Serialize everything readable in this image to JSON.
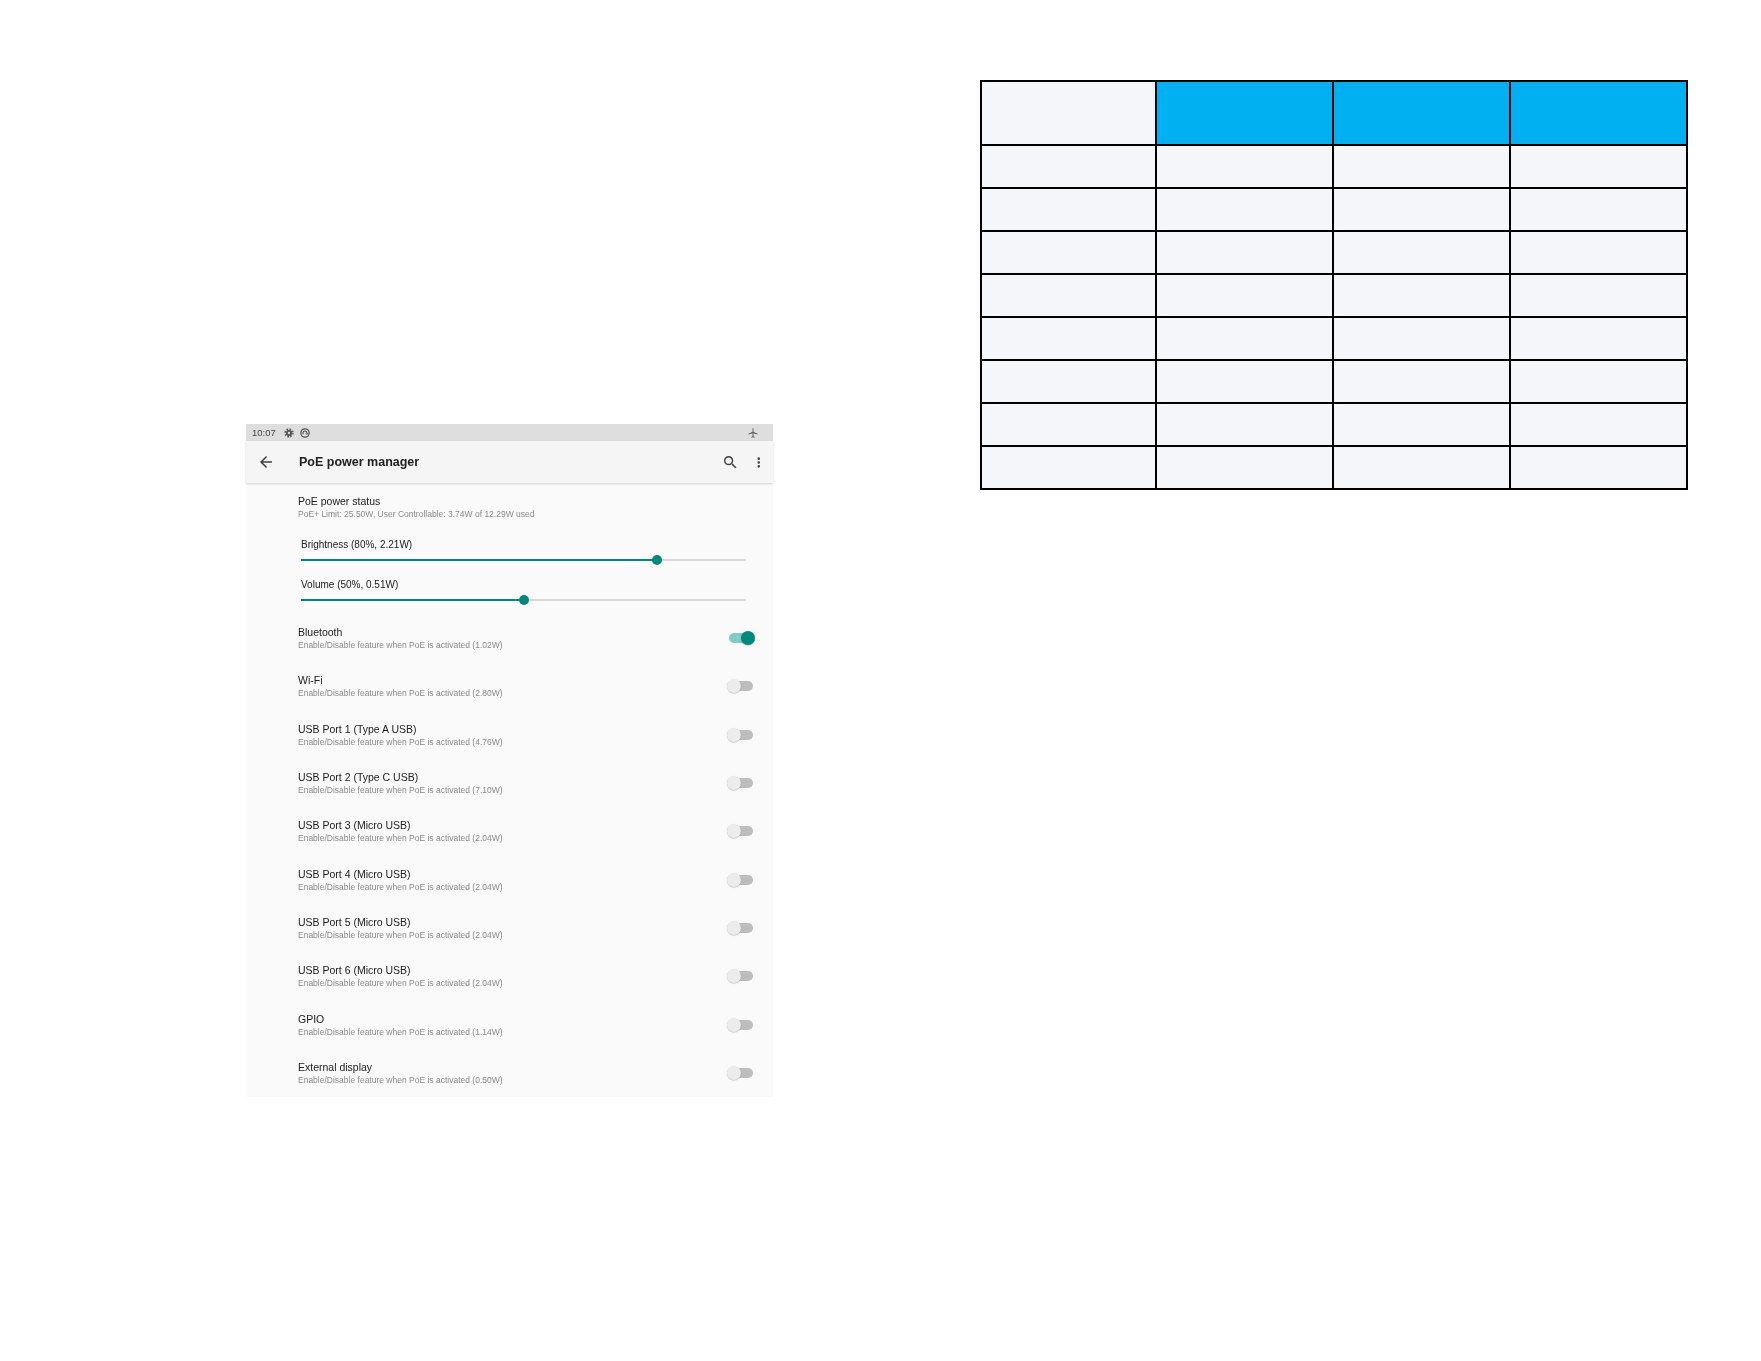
{
  "status_bar": {
    "time": "10:07"
  },
  "app_bar": {
    "title": "PoE power manager"
  },
  "power_status": {
    "title": "PoE power status",
    "summary": "PoE+ Limit: 25.50W, User Controllable: 3.74W of 12.29W used"
  },
  "sliders": [
    {
      "label": "Brightness (80%, 2.21W)",
      "level": 0.8
    },
    {
      "label": "Volume (50%, 0.51W)",
      "level": 0.5
    }
  ],
  "features": [
    {
      "name": "Bluetooth",
      "description": "Enable/Disable feature when PoE is activated (1.02W)",
      "on": true
    },
    {
      "name": "Wi-Fi",
      "description": "Enable/Disable feature when PoE is activated (2.80W)",
      "on": false
    },
    {
      "name": "USB Port 1 (Type A USB)",
      "description": "Enable/Disable feature when PoE is activated (4.76W)",
      "on": false
    },
    {
      "name": "USB Port 2 (Type C USB)",
      "description": "Enable/Disable feature when PoE is activated (7.10W)",
      "on": false
    },
    {
      "name": "USB Port 3 (Micro USB)",
      "description": "Enable/Disable feature when PoE is activated (2.04W)",
      "on": false
    },
    {
      "name": "USB Port 4 (Micro USB)",
      "description": "Enable/Disable feature when PoE is activated (2.04W)",
      "on": false
    },
    {
      "name": "USB Port 5 (Micro USB)",
      "description": "Enable/Disable feature when PoE is activated (2.04W)",
      "on": false
    },
    {
      "name": "USB Port 6 (Micro USB)",
      "description": "Enable/Disable feature when PoE is activated (2.04W)",
      "on": false
    },
    {
      "name": "GPIO",
      "description": "Enable/Disable feature when PoE is activated (1.14W)",
      "on": false
    },
    {
      "name": "External display",
      "description": "Enable/Disable feature when PoE is activated (0.50W)",
      "on": false
    }
  ],
  "table": {
    "header_cells": [
      {
        "color": "#f5f6fa"
      },
      {
        "color": "#00b0f0"
      },
      {
        "color": "#00b0f0"
      },
      {
        "color": "#00b0f0"
      }
    ],
    "rows": [
      {
        "cells": [
          {
            "color": "#f5f6fa"
          },
          {
            "color": "#f5f6fa"
          },
          {
            "color": "#f5f6fa"
          },
          {
            "color": "#f5f6fa"
          }
        ]
      },
      {
        "cells": [
          {
            "color": "#f5f6fa"
          },
          {
            "color": "#f5f6fa"
          },
          {
            "color": "#f5f6fa"
          },
          {
            "color": "#f5f6fa"
          }
        ]
      },
      {
        "cells": [
          {
            "color": "#f5f6fa"
          },
          {
            "color": "#f5f6fa"
          },
          {
            "color": "#f5f6fa"
          },
          {
            "color": "#f5f6fa"
          }
        ]
      },
      {
        "cells": [
          {
            "color": "#f5f6fa"
          },
          {
            "color": "#f5f6fa"
          },
          {
            "color": "#f5f6fa"
          },
          {
            "color": "#f5f6fa"
          }
        ]
      },
      {
        "cells": [
          {
            "color": "#f5f6fa"
          },
          {
            "color": "#f5f6fa"
          },
          {
            "color": "#f5f6fa"
          },
          {
            "color": "#f5f6fa"
          }
        ]
      },
      {
        "cells": [
          {
            "color": "#f5f6fa"
          },
          {
            "color": "#f5f6fa"
          },
          {
            "color": "#f5f6fa"
          },
          {
            "color": "#f5f6fa"
          }
        ]
      },
      {
        "cells": [
          {
            "color": "#f5f6fa"
          },
          {
            "color": "#f5f6fa"
          },
          {
            "color": "#f5f6fa"
          },
          {
            "color": "#f5f6fa"
          }
        ]
      },
      {
        "cells": [
          {
            "color": "#f5f6fa"
          },
          {
            "color": "#f5f6fa"
          },
          {
            "color": "#f5f6fa"
          },
          {
            "color": "#f5f6fa"
          }
        ]
      }
    ]
  }
}
